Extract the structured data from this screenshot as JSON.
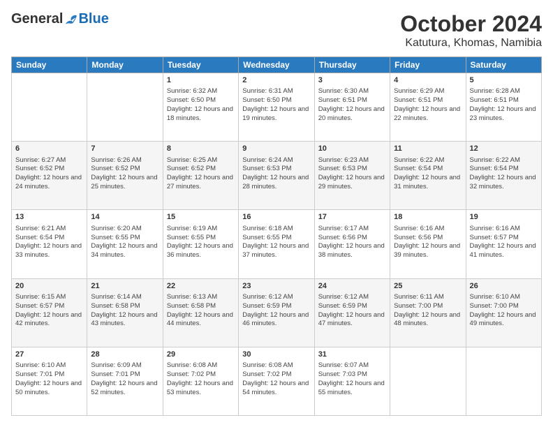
{
  "header": {
    "logo_general": "General",
    "logo_blue": "Blue",
    "month_title": "October 2024",
    "location": "Katutura, Khomas, Namibia"
  },
  "days_of_week": [
    "Sunday",
    "Monday",
    "Tuesday",
    "Wednesday",
    "Thursday",
    "Friday",
    "Saturday"
  ],
  "weeks": [
    [
      {
        "day": "",
        "sunrise": "",
        "sunset": "",
        "daylight": ""
      },
      {
        "day": "",
        "sunrise": "",
        "sunset": "",
        "daylight": ""
      },
      {
        "day": "1",
        "sunrise": "Sunrise: 6:32 AM",
        "sunset": "Sunset: 6:50 PM",
        "daylight": "Daylight: 12 hours and 18 minutes."
      },
      {
        "day": "2",
        "sunrise": "Sunrise: 6:31 AM",
        "sunset": "Sunset: 6:50 PM",
        "daylight": "Daylight: 12 hours and 19 minutes."
      },
      {
        "day": "3",
        "sunrise": "Sunrise: 6:30 AM",
        "sunset": "Sunset: 6:51 PM",
        "daylight": "Daylight: 12 hours and 20 minutes."
      },
      {
        "day": "4",
        "sunrise": "Sunrise: 6:29 AM",
        "sunset": "Sunset: 6:51 PM",
        "daylight": "Daylight: 12 hours and 22 minutes."
      },
      {
        "day": "5",
        "sunrise": "Sunrise: 6:28 AM",
        "sunset": "Sunset: 6:51 PM",
        "daylight": "Daylight: 12 hours and 23 minutes."
      }
    ],
    [
      {
        "day": "6",
        "sunrise": "Sunrise: 6:27 AM",
        "sunset": "Sunset: 6:52 PM",
        "daylight": "Daylight: 12 hours and 24 minutes."
      },
      {
        "day": "7",
        "sunrise": "Sunrise: 6:26 AM",
        "sunset": "Sunset: 6:52 PM",
        "daylight": "Daylight: 12 hours and 25 minutes."
      },
      {
        "day": "8",
        "sunrise": "Sunrise: 6:25 AM",
        "sunset": "Sunset: 6:52 PM",
        "daylight": "Daylight: 12 hours and 27 minutes."
      },
      {
        "day": "9",
        "sunrise": "Sunrise: 6:24 AM",
        "sunset": "Sunset: 6:53 PM",
        "daylight": "Daylight: 12 hours and 28 minutes."
      },
      {
        "day": "10",
        "sunrise": "Sunrise: 6:23 AM",
        "sunset": "Sunset: 6:53 PM",
        "daylight": "Daylight: 12 hours and 29 minutes."
      },
      {
        "day": "11",
        "sunrise": "Sunrise: 6:22 AM",
        "sunset": "Sunset: 6:54 PM",
        "daylight": "Daylight: 12 hours and 31 minutes."
      },
      {
        "day": "12",
        "sunrise": "Sunrise: 6:22 AM",
        "sunset": "Sunset: 6:54 PM",
        "daylight": "Daylight: 12 hours and 32 minutes."
      }
    ],
    [
      {
        "day": "13",
        "sunrise": "Sunrise: 6:21 AM",
        "sunset": "Sunset: 6:54 PM",
        "daylight": "Daylight: 12 hours and 33 minutes."
      },
      {
        "day": "14",
        "sunrise": "Sunrise: 6:20 AM",
        "sunset": "Sunset: 6:55 PM",
        "daylight": "Daylight: 12 hours and 34 minutes."
      },
      {
        "day": "15",
        "sunrise": "Sunrise: 6:19 AM",
        "sunset": "Sunset: 6:55 PM",
        "daylight": "Daylight: 12 hours and 36 minutes."
      },
      {
        "day": "16",
        "sunrise": "Sunrise: 6:18 AM",
        "sunset": "Sunset: 6:55 PM",
        "daylight": "Daylight: 12 hours and 37 minutes."
      },
      {
        "day": "17",
        "sunrise": "Sunrise: 6:17 AM",
        "sunset": "Sunset: 6:56 PM",
        "daylight": "Daylight: 12 hours and 38 minutes."
      },
      {
        "day": "18",
        "sunrise": "Sunrise: 6:16 AM",
        "sunset": "Sunset: 6:56 PM",
        "daylight": "Daylight: 12 hours and 39 minutes."
      },
      {
        "day": "19",
        "sunrise": "Sunrise: 6:16 AM",
        "sunset": "Sunset: 6:57 PM",
        "daylight": "Daylight: 12 hours and 41 minutes."
      }
    ],
    [
      {
        "day": "20",
        "sunrise": "Sunrise: 6:15 AM",
        "sunset": "Sunset: 6:57 PM",
        "daylight": "Daylight: 12 hours and 42 minutes."
      },
      {
        "day": "21",
        "sunrise": "Sunrise: 6:14 AM",
        "sunset": "Sunset: 6:58 PM",
        "daylight": "Daylight: 12 hours and 43 minutes."
      },
      {
        "day": "22",
        "sunrise": "Sunrise: 6:13 AM",
        "sunset": "Sunset: 6:58 PM",
        "daylight": "Daylight: 12 hours and 44 minutes."
      },
      {
        "day": "23",
        "sunrise": "Sunrise: 6:12 AM",
        "sunset": "Sunset: 6:59 PM",
        "daylight": "Daylight: 12 hours and 46 minutes."
      },
      {
        "day": "24",
        "sunrise": "Sunrise: 6:12 AM",
        "sunset": "Sunset: 6:59 PM",
        "daylight": "Daylight: 12 hours and 47 minutes."
      },
      {
        "day": "25",
        "sunrise": "Sunrise: 6:11 AM",
        "sunset": "Sunset: 7:00 PM",
        "daylight": "Daylight: 12 hours and 48 minutes."
      },
      {
        "day": "26",
        "sunrise": "Sunrise: 6:10 AM",
        "sunset": "Sunset: 7:00 PM",
        "daylight": "Daylight: 12 hours and 49 minutes."
      }
    ],
    [
      {
        "day": "27",
        "sunrise": "Sunrise: 6:10 AM",
        "sunset": "Sunset: 7:01 PM",
        "daylight": "Daylight: 12 hours and 50 minutes."
      },
      {
        "day": "28",
        "sunrise": "Sunrise: 6:09 AM",
        "sunset": "Sunset: 7:01 PM",
        "daylight": "Daylight: 12 hours and 52 minutes."
      },
      {
        "day": "29",
        "sunrise": "Sunrise: 6:08 AM",
        "sunset": "Sunset: 7:02 PM",
        "daylight": "Daylight: 12 hours and 53 minutes."
      },
      {
        "day": "30",
        "sunrise": "Sunrise: 6:08 AM",
        "sunset": "Sunset: 7:02 PM",
        "daylight": "Daylight: 12 hours and 54 minutes."
      },
      {
        "day": "31",
        "sunrise": "Sunrise: 6:07 AM",
        "sunset": "Sunset: 7:03 PM",
        "daylight": "Daylight: 12 hours and 55 minutes."
      },
      {
        "day": "",
        "sunrise": "",
        "sunset": "",
        "daylight": ""
      },
      {
        "day": "",
        "sunrise": "",
        "sunset": "",
        "daylight": ""
      }
    ]
  ]
}
